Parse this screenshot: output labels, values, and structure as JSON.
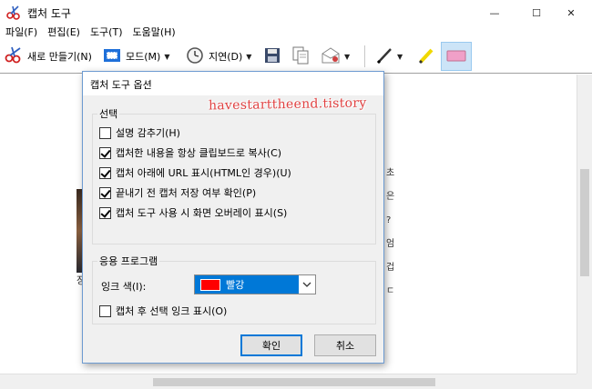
{
  "window": {
    "title": "캡처 도구",
    "minimize": "—",
    "maximize": "☐",
    "close": "✕"
  },
  "menu": [
    "파일(F)",
    "편집(E)",
    "도구(T)",
    "도움말(H)"
  ],
  "toolbar": {
    "new_label": "새로 만들기(N)",
    "mode_label": "모드(M)",
    "delay_label": "지연(D)"
  },
  "canvas": {
    "left_char": "장",
    "right_column": [
      "초",
      "은",
      "?",
      "엄",
      "겁",
      "ㄷ"
    ]
  },
  "dialog": {
    "title": "캡처 도구 옵션",
    "watermark": "havestarttheend.tistory",
    "selection_group": {
      "label": "선택",
      "options": [
        {
          "label": "설명 감추기(H)",
          "checked": false
        },
        {
          "label": "캡처한 내용을 항상 클립보드로 복사(C)",
          "checked": true
        },
        {
          "label": "캡처 아래에 URL 표시(HTML인 경우)(U)",
          "checked": true
        },
        {
          "label": "끝내기 전 캡처 저장 여부 확인(P)",
          "checked": true
        },
        {
          "label": "캡처 도구 사용 시 화면 오버레이 표시(S)",
          "checked": true
        }
      ]
    },
    "app_group": {
      "label": "응용 프로그램",
      "ink_color_label": "잉크 색(I):",
      "ink_color_value": "빨강",
      "ink_color_hex": "#ff0000",
      "show_ink_label": "캡처 후 선택 잉크 표시(O)",
      "show_ink_checked": false
    },
    "ok_label": "확인",
    "cancel_label": "취소"
  }
}
